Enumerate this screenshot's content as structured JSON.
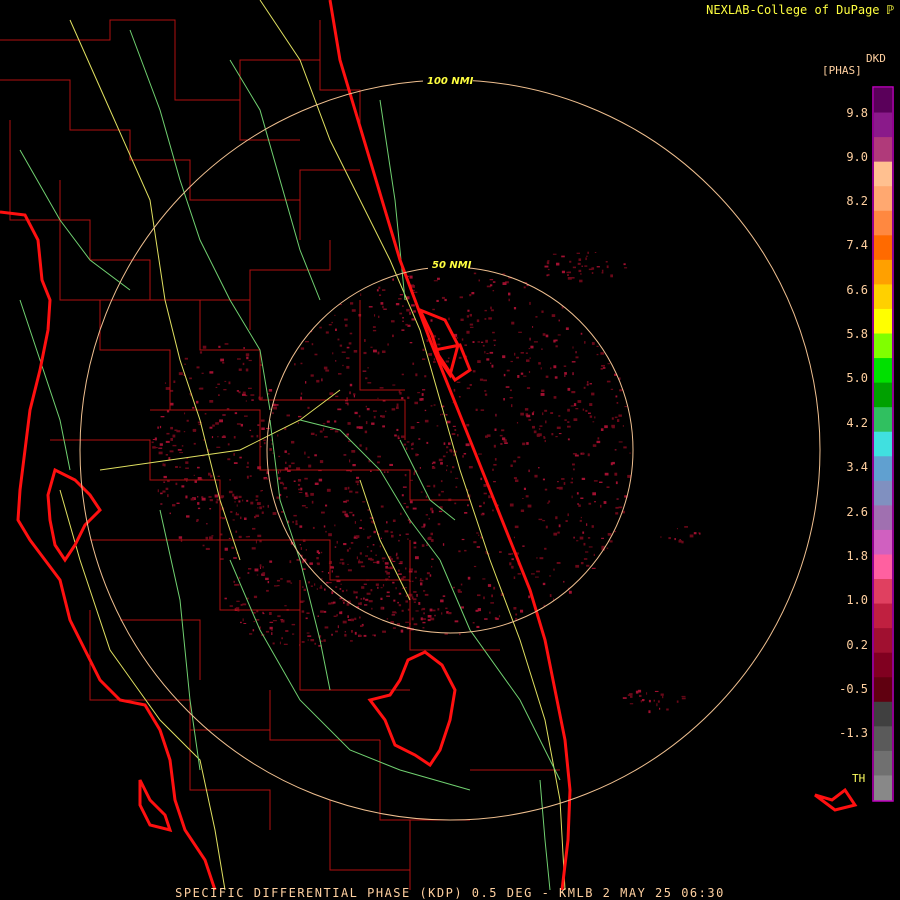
{
  "credit": "NEXLAB-College of DuPage",
  "units": {
    "top": "DKD",
    "bottom": "[PHAS]"
  },
  "footer": "SPECIFIC DIFFERENTIAL PHASE (KDP) 0.5 DEG - KMLB 2 MAY 25 06:30",
  "range_rings": [
    {
      "label": "50 NMI"
    },
    {
      "label": "100 NMI"
    }
  ],
  "legend": {
    "ticks": [
      "9.8",
      "9.0",
      "8.2",
      "7.4",
      "6.6",
      "5.8",
      "5.0",
      "4.2",
      "3.4",
      "2.6",
      "1.8",
      "1.0",
      "0.2",
      "-0.5",
      "-1.3"
    ],
    "th_label": "TH",
    "colors": [
      "#5a005a",
      "#8a1a8a",
      "#b03a7a",
      "#ffc090",
      "#ffa870",
      "#ff8840",
      "#ff6a00",
      "#ffa000",
      "#ffd000",
      "#ffff00",
      "#80ff00",
      "#00e000",
      "#00a000",
      "#30c060",
      "#40e0e0",
      "#60a0d0",
      "#8090c0",
      "#a070b0",
      "#d060c0",
      "#ff60a0",
      "#e04060",
      "#c02040",
      "#a01030",
      "#800020",
      "#600010",
      "#404040",
      "#5a5a5a",
      "#707070",
      "#888888"
    ]
  },
  "icons": {
    "logo": "nexlab-logo-icon"
  }
}
